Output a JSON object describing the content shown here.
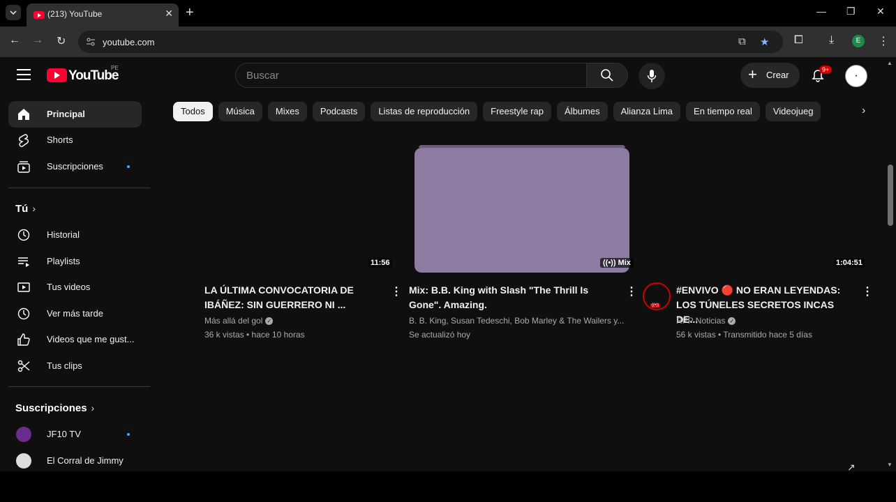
{
  "browser": {
    "tab_title": "(213) YouTube",
    "url": "youtube.com",
    "profile_initial": "E"
  },
  "header": {
    "logo_text": "YouTube",
    "country_code": "PE",
    "search_placeholder": "Buscar",
    "create_label": "Crear",
    "notifications_badge": "9+"
  },
  "sidebar": {
    "main": [
      {
        "label": "Principal",
        "icon": "home-icon",
        "active": true
      },
      {
        "label": "Shorts",
        "icon": "shorts-icon"
      },
      {
        "label": "Suscripciones",
        "icon": "subscriptions-icon",
        "dot": true
      }
    ],
    "you_heading": "Tú",
    "you": [
      {
        "label": "Historial",
        "icon": "history-icon"
      },
      {
        "label": "Playlists",
        "icon": "playlists-icon"
      },
      {
        "label": "Tus videos",
        "icon": "your-videos-icon"
      },
      {
        "label": "Ver más tarde",
        "icon": "watch-later-icon"
      },
      {
        "label": "Videos que me gust...",
        "icon": "liked-icon"
      },
      {
        "label": "Tus clips",
        "icon": "clips-icon"
      }
    ],
    "subs_heading": "Suscripciones",
    "subscriptions": [
      {
        "label": "JF10 TV",
        "dot": true
      },
      {
        "label": "El Corral de Jimmy"
      }
    ]
  },
  "chips": [
    "Todos",
    "Música",
    "Mixes",
    "Podcasts",
    "Listas de reproducción",
    "Freestyle rap",
    "Álbumes",
    "Alianza Lima",
    "En tiempo real",
    "Videojueg"
  ],
  "videos": [
    {
      "duration": "11:56",
      "title": "LA ÚLTIMA CONVOCATORIA DE IBÁÑEZ: SIN GUERRERO NI ...",
      "channel": "Más allá del gol",
      "meta": "36 k vistas • hace 10 horas"
    },
    {
      "badge": "Mix",
      "title": "Mix: B.B. King with Slash \"The Thrill Is Gone\". Amazing.",
      "channel": "B. B. King, Susan Tedeschi, Bob Marley & The Wailers y...",
      "meta": "Se actualizó hoy"
    },
    {
      "duration": "1:04:51",
      "title": "#ENVIVO 🔴 NO ERAN LEYENDAS: LOS TÚNELES SECRETOS INCAS DE...",
      "channel": "RPP Noticias",
      "meta": "56 k vistas • Transmitido hace 5 días"
    }
  ],
  "colors": {
    "background": "#0f0f0f",
    "brand_red": "#ff0033",
    "mix_thumbnail": "#8e7ba1",
    "accent_blue": "#3ea6ff"
  }
}
